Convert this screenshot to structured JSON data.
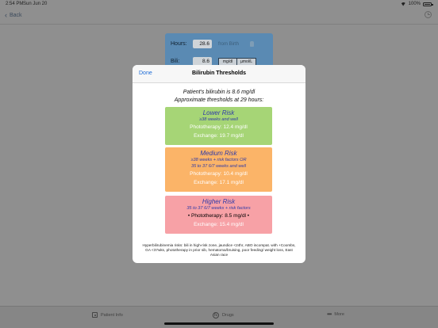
{
  "status_bar": {
    "time": "2:54 PM",
    "date": "Sun Jun 20",
    "battery": "100%"
  },
  "nav": {
    "back_label": "Back"
  },
  "calculator": {
    "hours_label": "Hours:",
    "hours_value": "28.6",
    "from_birth_label": "from Birth",
    "bili_label": "Bili:",
    "bili_value": "8.6",
    "unit_options": [
      "mg/dl",
      "µmol/L"
    ]
  },
  "modal": {
    "done_label": "Done",
    "title": "Bilirubin Thresholds",
    "summary_line1": "Patient's bilirubin is 8.6 mg/dl",
    "summary_line2": "Approximate thresholds at 29 hours:",
    "risks": [
      {
        "title": "Lower Risk",
        "subtitle_lines": [
          "≥38 weeks and well"
        ],
        "phototherapy": "Phototherapy: 12.4 mg/dl",
        "exchange": "Exchange: 19.7 mg/dl",
        "color": "#a6d576"
      },
      {
        "title": "Medium Risk",
        "subtitle_lines": [
          "≥38 weeks + risk factors OR",
          "35 to 37 6/7 weeks and well"
        ],
        "phototherapy": "Phototherapy: 10.4 mg/dl",
        "exchange": "Exchange: 17.1 mg/dl",
        "color": "#fbb468"
      },
      {
        "title": "Higher Risk",
        "subtitle_lines": [
          "35 to 37 6/7 weeks + risk factors"
        ],
        "phototherapy": "• Phototherapy: 8.5 mg/dl •",
        "exchange": "Exchange: 15.4 mg/dl",
        "color": "#f7a1a6"
      }
    ],
    "footnote": "Hyperbilirubinemia risks: bili in high-risk zone, jaundice <24hr, ABO incompat. with +Coombs, GA <37wks, phototherapy in prior sib, hematoma/bruising, poor feeding/ weight loss, East Asian race"
  },
  "tabs": [
    {
      "label": "Patient Info",
      "icon": "patient-info-icon"
    },
    {
      "label": "Drugs",
      "icon": "drugs-icon"
    },
    {
      "label": "More",
      "icon": "more-icon"
    }
  ],
  "colors": {
    "accent": "#1c6bd6",
    "risk_text": "#2f3aa8",
    "panel": "#5a8ab3"
  }
}
